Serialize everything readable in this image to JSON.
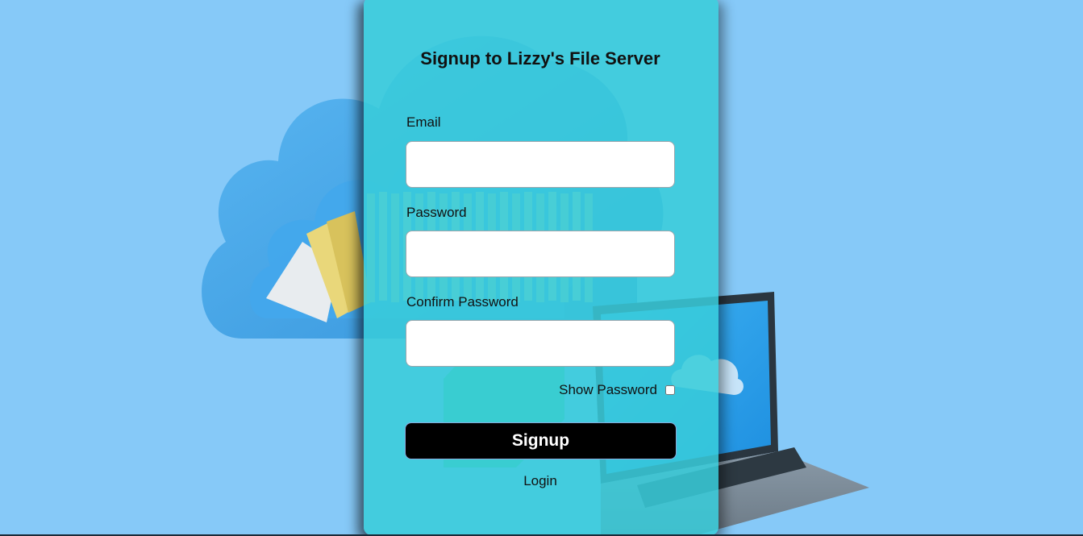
{
  "page": {
    "title": "Signup to Lizzy's File Server"
  },
  "form": {
    "email_label": "Email",
    "email_value": "",
    "password_label": "Password",
    "password_value": "",
    "confirm_label": "Confirm Password",
    "confirm_value": "",
    "show_password_label": "Show Password",
    "show_password_checked": false,
    "signup_label": "Signup",
    "login_link": "Login"
  },
  "colors": {
    "background": "#86c9f8",
    "card": "#38ccda",
    "button": "#000000",
    "button_text": "#ffffff"
  },
  "icons": {
    "background_art": "cloud-folders-laptop-illustration"
  }
}
